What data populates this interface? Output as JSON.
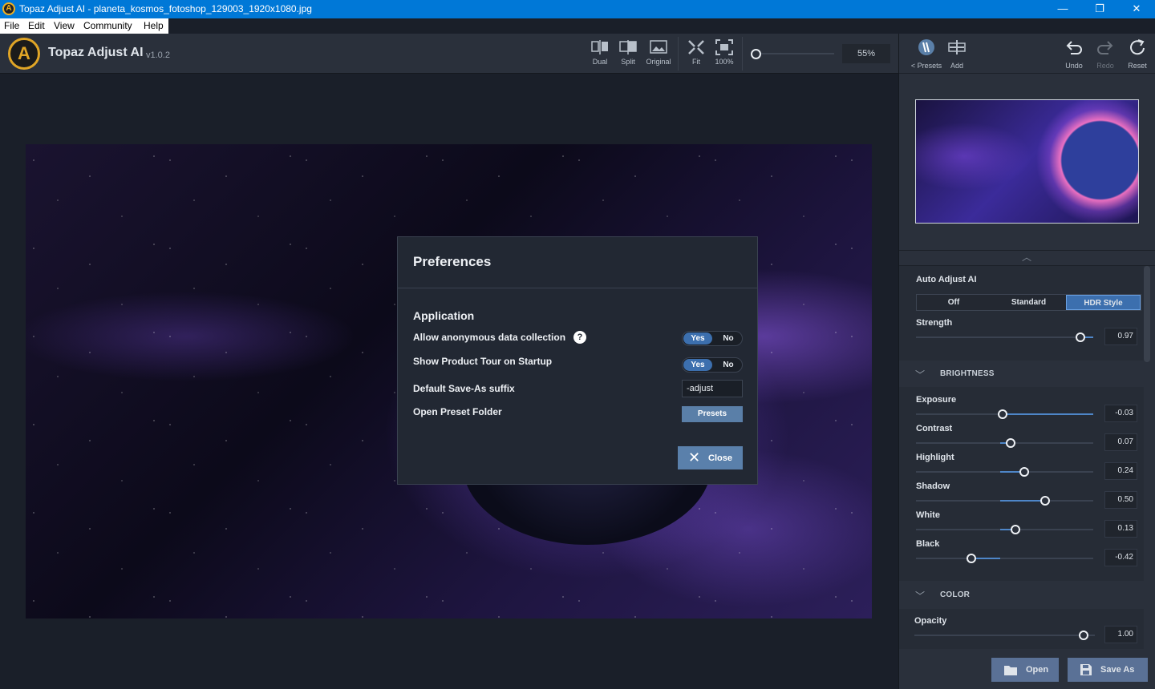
{
  "window": {
    "title": "Topaz Adjust AI - planeta_kosmos_fotoshop_129003_1920x1080.jpg",
    "app_icon_letter": "A",
    "minimize": "—",
    "maximize": "❐",
    "close": "✕"
  },
  "menu": [
    "File",
    "Edit",
    "View",
    "Community",
    "Help"
  ],
  "header": {
    "logo_letter": "A",
    "app_name": "Topaz Adjust AI",
    "version": "v1.0.2",
    "view_tools": [
      {
        "label": "Dual",
        "icon": "dual-view-icon"
      },
      {
        "label": "Split",
        "icon": "split-view-icon"
      },
      {
        "label": "Original",
        "icon": "image-icon"
      },
      {
        "label": "Fit",
        "icon": "fit-icon"
      },
      {
        "label": "100%",
        "icon": "actual-size-icon"
      }
    ],
    "zoom": "55%",
    "panel_tools": [
      {
        "label": "< Presets",
        "icon": "presets-icon"
      },
      {
        "label": "Add",
        "icon": "add-preset-icon"
      },
      {
        "label": "Undo",
        "icon": "undo-icon"
      },
      {
        "label": "Redo",
        "icon": "redo-icon"
      },
      {
        "label": "Reset",
        "icon": "reset-icon"
      }
    ]
  },
  "dialog": {
    "title": "Preferences",
    "section": "Application",
    "help_glyph": "?",
    "rows": [
      {
        "label": "Allow anonymous data collection",
        "yes": "Yes",
        "no": "No",
        "value": "Yes"
      },
      {
        "label": "Show Product Tour on Startup",
        "yes": "Yes",
        "no": "No",
        "value": "Yes"
      },
      {
        "label": "Default Save-As suffix",
        "value": "-adjust"
      },
      {
        "label": "Open Preset Folder",
        "button": "Presets"
      }
    ],
    "close_label": "Close",
    "close_icon": "close-icon"
  },
  "panel": {
    "auto_adjust": {
      "title": "Auto Adjust AI",
      "modes": [
        "Off",
        "Standard",
        "HDR Style"
      ],
      "selected": "HDR Style",
      "strength_label": "Strength",
      "strength_value": "0.97",
      "strength_level": 0.97
    },
    "brightness": {
      "title": "BRIGHTNESS",
      "sliders": [
        {
          "label": "Exposure",
          "value": "-0.03",
          "level": -0.03
        },
        {
          "label": "Contrast",
          "value": "0.07",
          "level": 0.07
        },
        {
          "label": "Highlight",
          "value": "0.24",
          "level": 0.24
        },
        {
          "label": "Shadow",
          "value": "0.50",
          "level": 0.5
        },
        {
          "label": "White",
          "value": "0.13",
          "level": 0.13
        },
        {
          "label": "Black",
          "value": "-0.42",
          "level": -0.42
        }
      ]
    },
    "color": {
      "title": "COLOR",
      "opacity_label": "Opacity",
      "opacity_value": "1.00",
      "opacity_level": 1.0
    },
    "footer": {
      "open_label": "Open",
      "save_as_label": "Save As"
    }
  },
  "colors": {
    "accent": "#3c6fae",
    "button": "#5a80ab",
    "brand": "#e0a526"
  }
}
